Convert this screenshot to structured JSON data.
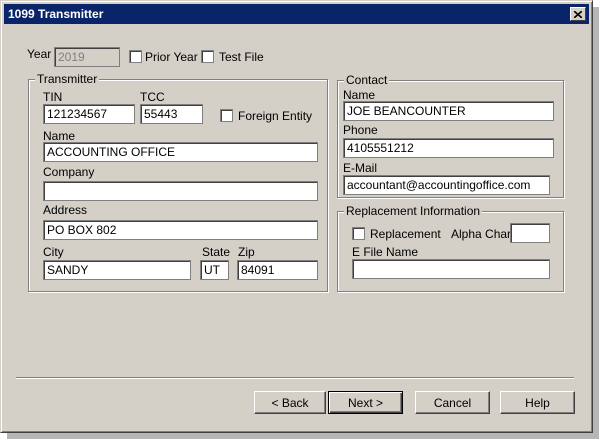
{
  "window": {
    "title": "1099 Transmitter"
  },
  "top": {
    "year_label": "Year",
    "year_value": "2019",
    "prior_year_label": "Prior Year",
    "test_file_label": "Test File"
  },
  "transmitter": {
    "group_title": "Transmitter",
    "tin_label": "TIN",
    "tin_value": "121234567",
    "tcc_label": "TCC",
    "tcc_value": "55443",
    "foreign_entity_label": "Foreign Entity",
    "name_label": "Name",
    "name_value": "ACCOUNTING OFFICE",
    "company_label": "Company",
    "company_value": "",
    "address_label": "Address",
    "address_value": "PO BOX 802",
    "city_label": "City",
    "city_value": "SANDY",
    "state_label": "State",
    "state_value": "UT",
    "zip_label": "Zip",
    "zip_value": "84091"
  },
  "contact": {
    "group_title": "Contact",
    "name_label": "Name",
    "name_value": "JOE BEANCOUNTER",
    "phone_label": "Phone",
    "phone_value": "4105551212",
    "email_label": "E-Mail",
    "email_value": "accountant@accountingoffice.com"
  },
  "replacement": {
    "group_title": "Replacement Information",
    "replacement_label": "Replacement",
    "alpha_char_label": "Alpha Char",
    "alpha_char_value": "",
    "efile_name_label": "E File Name",
    "efile_name_value": ""
  },
  "buttons": {
    "back": "< Back",
    "next": "Next >",
    "cancel": "Cancel",
    "help": "Help"
  }
}
